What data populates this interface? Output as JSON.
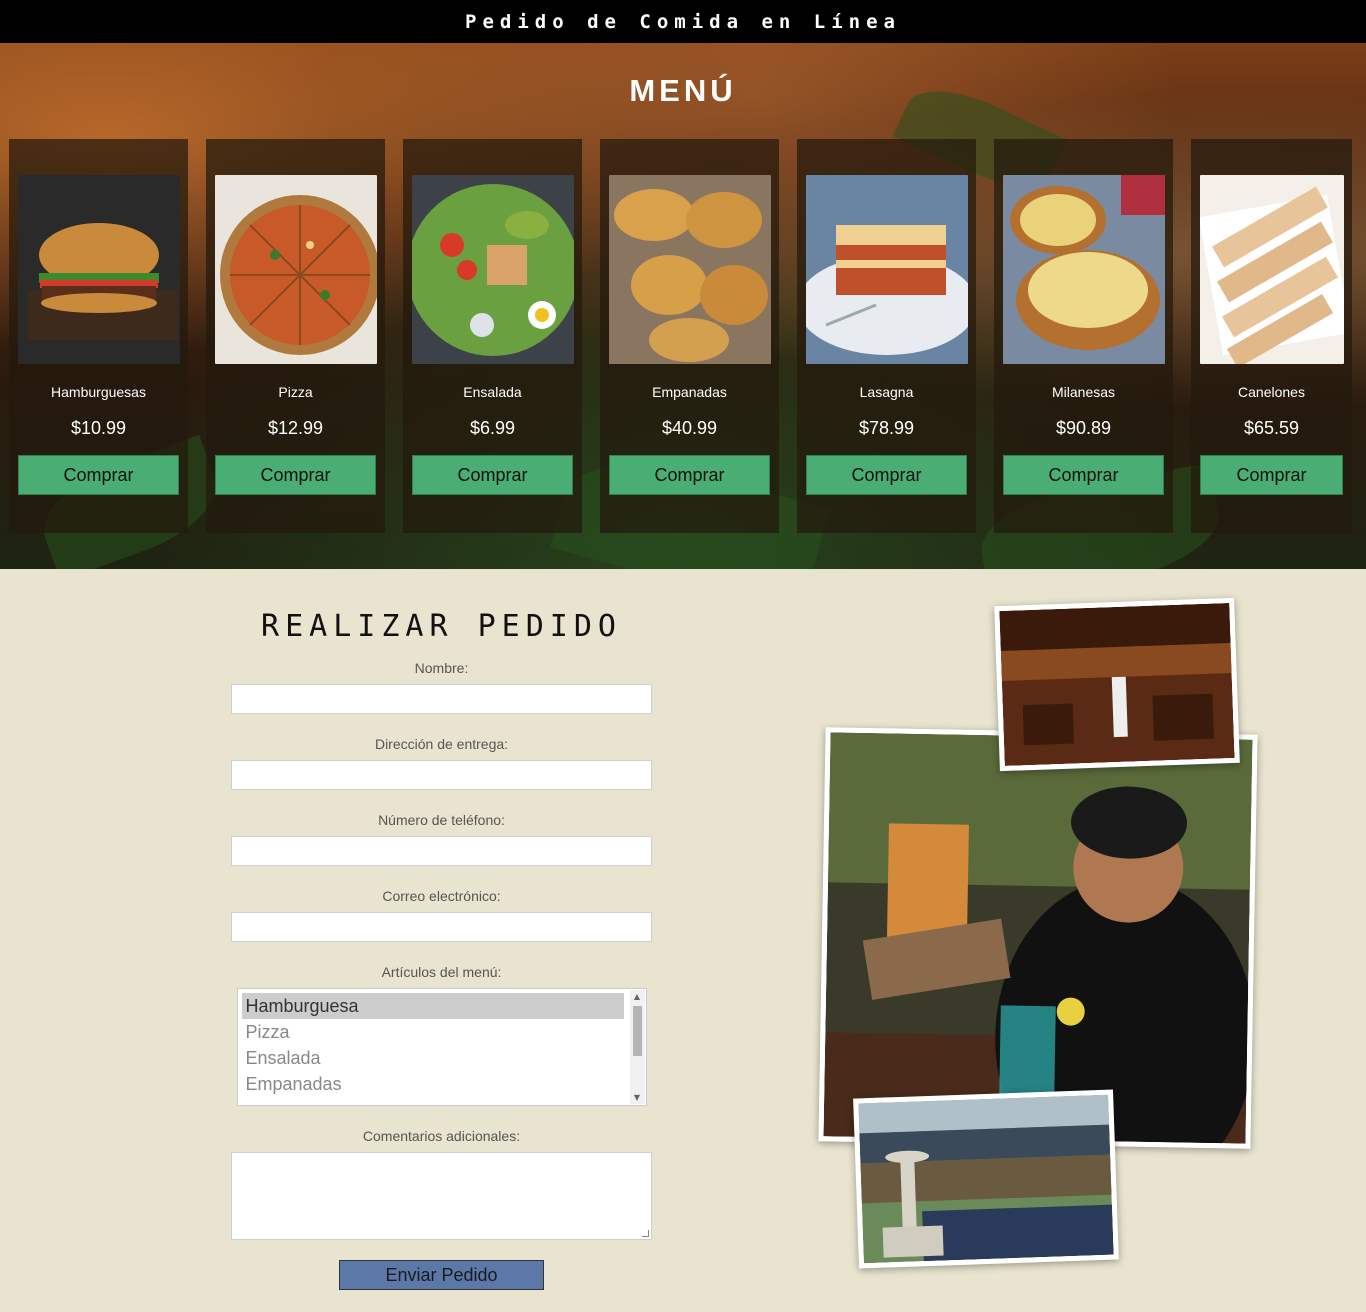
{
  "site": {
    "title": "Pedido de Comida en Línea"
  },
  "menu": {
    "title": "MENÚ",
    "buy_label": "Comprar",
    "items": [
      {
        "name": "Hamburguesas",
        "price": "$10.99",
        "image": "burger"
      },
      {
        "name": "Pizza",
        "price": "$12.99",
        "image": "pizza"
      },
      {
        "name": "Ensalada",
        "price": "$6.99",
        "image": "salad"
      },
      {
        "name": "Empanadas",
        "price": "$40.99",
        "image": "empanadas"
      },
      {
        "name": "Lasagna",
        "price": "$78.99",
        "image": "lasagna"
      },
      {
        "name": "Milanesas",
        "price": "$90.89",
        "image": "milanesas"
      },
      {
        "name": "Canelones",
        "price": "$65.59",
        "image": "canelones"
      }
    ]
  },
  "order": {
    "title": "REALIZAR PEDIDO",
    "labels": {
      "name": "Nombre:",
      "address": "Dirección de entrega:",
      "phone": "Número de teléfono:",
      "email": "Correo electrónico:",
      "items": "Artículos del menú:",
      "comments": "Comentarios adicionales:"
    },
    "fields": {
      "name": "",
      "address": "",
      "phone": "",
      "email": "",
      "comments": ""
    },
    "menu_options": [
      "Hamburguesa",
      "Pizza",
      "Ensalada",
      "Empanadas"
    ],
    "selected_option": "Hamburguesa",
    "submit_label": "Enviar Pedido"
  },
  "colors": {
    "buy_button": "#49ad74",
    "submit_button": "#5b78a8",
    "order_bg": "#e8e4cf",
    "topbar": "#000000"
  },
  "icons": {
    "listbox_up": "triangle-up-icon",
    "listbox_down": "triangle-down-icon"
  }
}
